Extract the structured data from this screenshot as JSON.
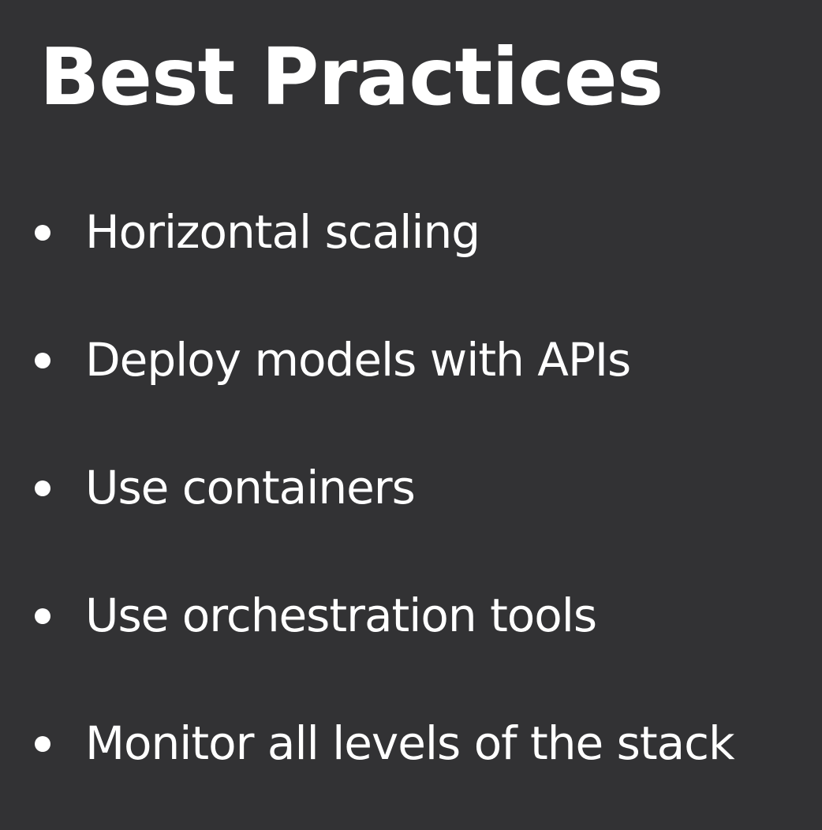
{
  "slide": {
    "title": "Best Practices",
    "bullets": [
      "Horizontal scaling",
      "Deploy models with APIs",
      "Use containers",
      "Use orchestration tools",
      "Monitor all levels of the stack"
    ]
  },
  "colors": {
    "background": "#323234",
    "text": "#ffffff"
  }
}
